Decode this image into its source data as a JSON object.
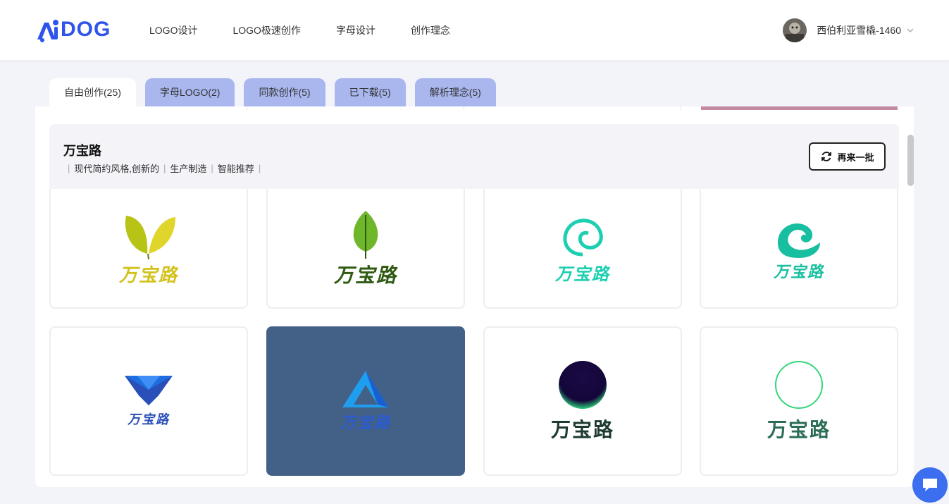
{
  "app": {
    "logo_text": "DOG",
    "logo_prefix": "Ai"
  },
  "nav": {
    "items": [
      {
        "label": "LOGO设计"
      },
      {
        "label": "LOGO极速创作"
      },
      {
        "label": "字母设计"
      },
      {
        "label": "创作理念"
      }
    ]
  },
  "user": {
    "name": "西伯利亚雪橇-1460"
  },
  "tabs": [
    {
      "label": "自由创作(25)",
      "active": true
    },
    {
      "label": "字母LOGO(2)",
      "active": false
    },
    {
      "label": "同款创作(5)",
      "active": false
    },
    {
      "label": "已下载(5)",
      "active": false
    },
    {
      "label": "解析理念(5)",
      "active": false
    }
  ],
  "brand": {
    "name": "万宝路",
    "tags": [
      "现代简约风格,创新的",
      "生产制造",
      "智能推荐"
    ]
  },
  "refresh_label": "再来一批",
  "cards": [
    {
      "text": "万宝路",
      "icon": "leaf-pair-icon",
      "color": "#c9c41a"
    },
    {
      "text": "万宝路",
      "icon": "leaf-icon",
      "color": "#2f5a12"
    },
    {
      "text": "万宝路",
      "icon": "spiral-icon",
      "color": "#1ccfb0"
    },
    {
      "text": "万宝路",
      "icon": "wave-icon",
      "color": "#17bfa0"
    },
    {
      "text": "万宝路",
      "icon": "v-shape-icon",
      "color": "#2a4fb8"
    },
    {
      "text": "万宝路",
      "icon": "a-triangle-icon",
      "color": "#2a5bd0"
    },
    {
      "text": "万宝路",
      "icon": "dark-circle-icon",
      "color": "#1d3a30"
    },
    {
      "text": "万宝路",
      "icon": "ring-icon",
      "color": "#2b6e55"
    }
  ],
  "colors": {
    "accent": "#3b6ff0",
    "tab_inactive": "#a9b7ee",
    "dark_card": "#436187"
  }
}
